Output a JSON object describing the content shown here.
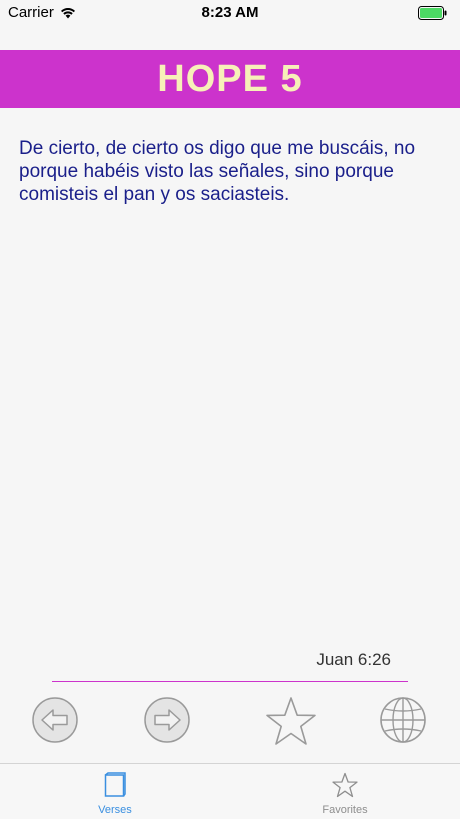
{
  "status_bar": {
    "carrier": "Carrier",
    "time": "8:23 AM",
    "wifi_icon": "wifi-icon",
    "battery_icon": "battery-icon",
    "battery_color": "#4cd964"
  },
  "header": {
    "title": "HOPE 5",
    "background_color": "#cc33cc",
    "title_color": "#f7f0b8"
  },
  "verse": {
    "text": "De cierto, de cierto os digo que me buscáis, no porque habéis visto las señales, sino porque comisteis el pan y os saciasteis.",
    "reference": "Juan 6:26",
    "text_color": "#1a1f8a"
  },
  "controls": {
    "previous_icon": "arrow-left-circle-icon",
    "next_icon": "arrow-right-circle-icon",
    "favorite_icon": "star-icon",
    "globe_icon": "globe-icon"
  },
  "tab_bar": {
    "tabs": [
      {
        "label": "Verses",
        "icon": "book-icon",
        "active": true,
        "color": "#3a8fe0"
      },
      {
        "label": "Favorites",
        "icon": "star-icon",
        "active": false,
        "color": "#8e8e8e"
      }
    ]
  }
}
